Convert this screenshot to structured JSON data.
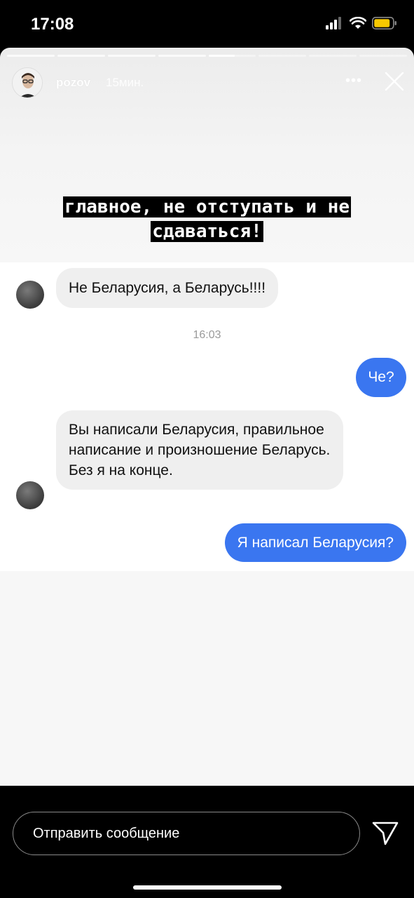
{
  "status_bar": {
    "time": "17:08",
    "icons": [
      "signal-icon",
      "wifi-icon",
      "battery-icon"
    ],
    "battery_color": "#f7c900"
  },
  "story": {
    "username": "pozov",
    "posted_ago": "15мин.",
    "more_label": "•••",
    "caption_lines": [
      "главное, не отступать и не",
      "сдаваться!"
    ],
    "progress": {
      "segments": 8,
      "completed": 4,
      "current_fraction": 0.55
    }
  },
  "chat": {
    "messages": [
      {
        "direction": "in",
        "text": "Не Беларусия, а Беларусь!!!!"
      },
      {
        "direction": "out",
        "text": "Че?"
      },
      {
        "direction": "in",
        "text": "Вы написали Беларусия, правильное написание и произношение Беларусь. Без я на конце."
      },
      {
        "direction": "out",
        "text": "Я написал Беларусия?"
      }
    ],
    "timestamp": "16:03",
    "colors": {
      "outgoing": "#3a76f0",
      "incoming": "#efefef"
    }
  },
  "composer": {
    "placeholder": "Отправить сообщение",
    "send_icon": "send-icon"
  }
}
